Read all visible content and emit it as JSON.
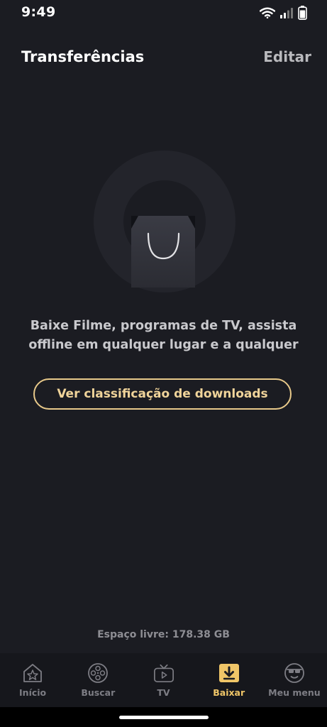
{
  "status_bar": {
    "time": "9:49"
  },
  "header": {
    "title": "Transferências",
    "edit_label": "Editar"
  },
  "empty_state": {
    "message_line1": "Baixe Filme, programas de TV, assista",
    "message_line2": "offline em qualquer lugar e a qualquer",
    "cta_label": "Ver classificação de downloads"
  },
  "storage": {
    "label": "Espaço livre: 178.38 GB"
  },
  "tabs": [
    {
      "label": "Início",
      "icon": "home-star-icon",
      "active": false
    },
    {
      "label": "Buscar",
      "icon": "film-reel-icon",
      "active": false
    },
    {
      "label": "TV",
      "icon": "tv-icon",
      "active": false
    },
    {
      "label": "Baixar",
      "icon": "download-icon",
      "active": true
    },
    {
      "label": "Meu menu",
      "icon": "profile-glasses-icon",
      "active": false
    }
  ],
  "colors": {
    "background": "#1b1c22",
    "accent": "#f0c668",
    "cta_border": "#e8c98a",
    "tab_bar": "#16171c"
  }
}
